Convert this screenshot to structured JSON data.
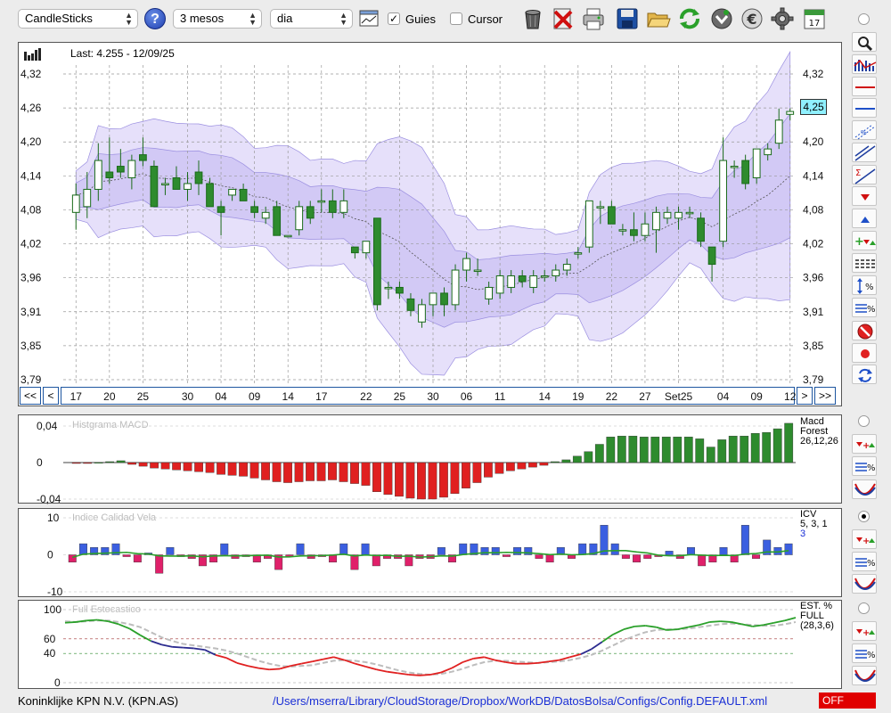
{
  "toolbar": {
    "chart_type": "CandleSticks",
    "period": "3 mesos",
    "interval": "dia",
    "guides_label": "Guies",
    "guides_checked": "✓",
    "cursor_label": "Cursor",
    "help": "?",
    "calendar_day": "17"
  },
  "nav": {
    "first": "<<",
    "prev": "<",
    "next": ">",
    "last": ">>"
  },
  "main_panel": {
    "last_info": "Last: 4.255 - 12/09/25",
    "price_tag": "4,25"
  },
  "macd_panel": {
    "label": "Histgrama MACD",
    "param1": "Macd",
    "param2": "Forest",
    "param3": "26,12,26",
    "ticks": [
      "0,04",
      "0",
      "-0,04"
    ]
  },
  "icv_panel": {
    "label": "Indice Calidad Vela",
    "param1": "ICV",
    "param2": "5, 3, 1",
    "param3": "3",
    "ticks": [
      "10",
      "0",
      "-10"
    ]
  },
  "stoch_panel": {
    "label": "Full Estocastico",
    "param1": "EST. %",
    "param2": "FULL",
    "param3": "(28,3,6)",
    "ticks": [
      "100",
      "60",
      "40",
      "0"
    ]
  },
  "status": {
    "security": "Koninklijke KPN N.V. (KPN.AS)",
    "path": "/Users/mserra/Library/CloudStorage/Dropbox/WorkDB/DatosBolsa/Configs/Config.DEFAULT.xml",
    "mode": "OFF"
  },
  "chart_data": {
    "type": "candlestick",
    "last_value": 4.255,
    "y_ticks": [
      "4,32",
      "4,26",
      "4,20",
      "4,14",
      "4,08",
      "4,02",
      "3,96",
      "3,91",
      "3,85",
      "3,79"
    ],
    "ylim": [
      3.79,
      4.32
    ],
    "x_labels": [
      "17",
      "20",
      "25",
      "30",
      "04",
      "09",
      "14",
      "17",
      "22",
      "25",
      "30",
      "06",
      "11",
      "14",
      "19",
      "22",
      "27",
      "Set25",
      "04",
      "09",
      "12"
    ],
    "candles": [
      {
        "o": 4.08,
        "h": 4.13,
        "l": 4.05,
        "c": 4.11
      },
      {
        "o": 4.09,
        "h": 4.15,
        "l": 4.07,
        "c": 4.12
      },
      {
        "o": 4.12,
        "h": 4.2,
        "l": 4.1,
        "c": 4.17
      },
      {
        "o": 4.15,
        "h": 4.21,
        "l": 4.13,
        "c": 4.14
      },
      {
        "o": 4.16,
        "h": 4.19,
        "l": 4.14,
        "c": 4.15
      },
      {
        "o": 4.14,
        "h": 4.18,
        "l": 4.12,
        "c": 4.17
      },
      {
        "o": 4.18,
        "h": 4.21,
        "l": 4.16,
        "c": 4.17
      },
      {
        "o": 4.16,
        "h": 4.17,
        "l": 4.09,
        "c": 4.09
      },
      {
        "o": 4.13,
        "h": 4.14,
        "l": 4.11,
        "c": 4.13
      },
      {
        "o": 4.14,
        "h": 4.16,
        "l": 4.12,
        "c": 4.12
      },
      {
        "o": 4.12,
        "h": 4.15,
        "l": 4.1,
        "c": 4.13
      },
      {
        "o": 4.15,
        "h": 4.17,
        "l": 4.11,
        "c": 4.13
      },
      {
        "o": 4.13,
        "h": 4.14,
        "l": 4.09,
        "c": 4.09
      },
      {
        "o": 4.09,
        "h": 4.1,
        "l": 4.04,
        "c": 4.08
      },
      {
        "o": 4.11,
        "h": 4.12,
        "l": 4.1,
        "c": 4.12
      },
      {
        "o": 4.12,
        "h": 4.13,
        "l": 4.1,
        "c": 4.1
      },
      {
        "o": 4.09,
        "h": 4.1,
        "l": 4.07,
        "c": 4.08
      },
      {
        "o": 4.07,
        "h": 4.09,
        "l": 4.06,
        "c": 4.08
      },
      {
        "o": 4.09,
        "h": 4.1,
        "l": 4.04,
        "c": 4.04
      },
      {
        "o": 4.04,
        "h": 4.04,
        "l": 4.04,
        "c": 4.04
      },
      {
        "o": 4.05,
        "h": 4.1,
        "l": 4.04,
        "c": 4.09
      },
      {
        "o": 4.09,
        "h": 4.1,
        "l": 4.06,
        "c": 4.07
      },
      {
        "o": 4.1,
        "h": 4.12,
        "l": 4.08,
        "c": 4.1
      },
      {
        "o": 4.1,
        "h": 4.12,
        "l": 4.07,
        "c": 4.08
      },
      {
        "o": 4.08,
        "h": 4.12,
        "l": 4.07,
        "c": 4.1
      },
      {
        "o": 4.02,
        "h": 4.02,
        "l": 4.0,
        "c": 4.01
      },
      {
        "o": 4.01,
        "h": 4.03,
        "l": 4.0,
        "c": 4.03
      },
      {
        "o": 4.07,
        "h": 4.07,
        "l": 3.91,
        "c": 3.92
      },
      {
        "o": 3.95,
        "h": 3.96,
        "l": 3.93,
        "c": 3.95
      },
      {
        "o": 3.95,
        "h": 3.96,
        "l": 3.93,
        "c": 3.94
      },
      {
        "o": 3.93,
        "h": 3.94,
        "l": 3.9,
        "c": 3.91
      },
      {
        "o": 3.89,
        "h": 3.93,
        "l": 3.88,
        "c": 3.92
      },
      {
        "o": 3.92,
        "h": 3.94,
        "l": 3.9,
        "c": 3.94
      },
      {
        "o": 3.94,
        "h": 3.95,
        "l": 3.9,
        "c": 3.92
      },
      {
        "o": 3.92,
        "h": 3.99,
        "l": 3.91,
        "c": 3.98
      },
      {
        "o": 3.98,
        "h": 4.01,
        "l": 3.96,
        "c": 4.0
      },
      {
        "o": 3.98,
        "h": 4.0,
        "l": 3.97,
        "c": 3.98
      },
      {
        "o": 3.93,
        "h": 3.96,
        "l": 3.92,
        "c": 3.95
      },
      {
        "o": 3.94,
        "h": 3.98,
        "l": 3.93,
        "c": 3.97
      },
      {
        "o": 3.95,
        "h": 3.98,
        "l": 3.94,
        "c": 3.97
      },
      {
        "o": 3.97,
        "h": 3.98,
        "l": 3.95,
        "c": 3.96
      },
      {
        "o": 3.95,
        "h": 3.98,
        "l": 3.94,
        "c": 3.97
      },
      {
        "o": 3.97,
        "h": 3.98,
        "l": 3.96,
        "c": 3.97
      },
      {
        "o": 3.97,
        "h": 3.99,
        "l": 3.96,
        "c": 3.98
      },
      {
        "o": 3.98,
        "h": 4.0,
        "l": 3.97,
        "c": 3.99
      },
      {
        "o": 4.01,
        "h": 4.02,
        "l": 4.0,
        "c": 4.01
      },
      {
        "o": 4.02,
        "h": 4.1,
        "l": 4.01,
        "c": 4.1
      },
      {
        "o": 4.09,
        "h": 4.1,
        "l": 4.06,
        "c": 4.09
      },
      {
        "o": 4.09,
        "h": 4.1,
        "l": 4.06,
        "c": 4.06
      },
      {
        "o": 4.05,
        "h": 4.06,
        "l": 4.04,
        "c": 4.05
      },
      {
        "o": 4.05,
        "h": 4.08,
        "l": 4.03,
        "c": 4.04
      },
      {
        "o": 4.04,
        "h": 4.08,
        "l": 4.03,
        "c": 4.06
      },
      {
        "o": 4.05,
        "h": 4.09,
        "l": 4.01,
        "c": 4.08
      },
      {
        "o": 4.07,
        "h": 4.09,
        "l": 4.06,
        "c": 4.08
      },
      {
        "o": 4.07,
        "h": 4.09,
        "l": 4.05,
        "c": 4.08
      },
      {
        "o": 4.08,
        "h": 4.09,
        "l": 4.07,
        "c": 4.08
      },
      {
        "o": 4.07,
        "h": 4.08,
        "l": 4.02,
        "c": 4.03
      },
      {
        "o": 4.02,
        "h": 4.02,
        "l": 3.96,
        "c": 3.99
      },
      {
        "o": 4.03,
        "h": 4.21,
        "l": 4.02,
        "c": 4.17
      },
      {
        "o": 4.16,
        "h": 4.17,
        "l": 4.14,
        "c": 4.16
      },
      {
        "o": 4.17,
        "h": 4.18,
        "l": 4.12,
        "c": 4.13
      },
      {
        "o": 4.14,
        "h": 4.19,
        "l": 4.13,
        "c": 4.19
      },
      {
        "o": 4.18,
        "h": 4.2,
        "l": 4.17,
        "c": 4.19
      },
      {
        "o": 4.2,
        "h": 4.26,
        "l": 4.19,
        "c": 4.24
      },
      {
        "o": 4.25,
        "h": 4.26,
        "l": 4.24,
        "c": 4.255
      }
    ],
    "macd_histogram": [
      -0.0005,
      -0.0005,
      0.0002,
      0.001,
      0.002,
      -0.002,
      -0.004,
      -0.006,
      -0.007,
      -0.008,
      -0.009,
      -0.01,
      -0.011,
      -0.013,
      -0.014,
      -0.015,
      -0.017,
      -0.019,
      -0.021,
      -0.022,
      -0.021,
      -0.02,
      -0.02,
      -0.019,
      -0.021,
      -0.023,
      -0.025,
      -0.032,
      -0.035,
      -0.037,
      -0.039,
      -0.04,
      -0.04,
      -0.038,
      -0.034,
      -0.028,
      -0.022,
      -0.016,
      -0.012,
      -0.009,
      -0.007,
      -0.005,
      -0.003,
      0.001,
      0.003,
      0.007,
      0.012,
      0.02,
      0.028,
      0.029,
      0.029,
      0.028,
      0.028,
      0.028,
      0.028,
      0.028,
      0.026,
      0.017,
      0.025,
      0.029,
      0.029,
      0.032,
      0.033,
      0.037,
      0.043
    ],
    "icv_bars": [
      -2,
      3,
      2,
      2,
      3,
      -0.5,
      -2,
      0.5,
      -5,
      2,
      -0.5,
      -1,
      -3,
      -2,
      3,
      -1,
      -0.5,
      -2,
      -1,
      -4,
      -0.5,
      3,
      -1,
      -0.5,
      -2,
      3,
      -4,
      3,
      -3,
      -1,
      -1,
      -3,
      -1,
      -1,
      2,
      -2,
      3,
      3,
      2,
      2,
      -0.5,
      2,
      2,
      -1,
      -2,
      2,
      -1,
      3,
      3,
      8,
      3,
      -1,
      -2,
      -1,
      -0.5,
      1,
      -1,
      2,
      -3,
      -2,
      2,
      -2,
      8,
      -1,
      4,
      2,
      3
    ],
    "stoch_k": [
      82,
      83,
      85,
      86,
      84,
      80,
      74,
      65,
      57,
      52,
      49,
      48,
      47,
      45,
      38,
      34,
      27,
      23,
      20,
      18,
      19,
      23,
      26,
      29,
      32,
      35,
      31,
      26,
      22,
      18,
      15,
      13,
      11,
      10,
      11,
      14,
      20,
      28,
      33,
      35,
      31,
      28,
      26,
      26,
      27,
      29,
      31,
      35,
      39,
      46,
      56,
      66,
      73,
      77,
      78,
      76,
      72,
      73,
      76,
      79,
      83,
      84,
      83,
      80,
      77,
      79,
      82,
      85,
      89
    ],
    "stoch_d": [
      84,
      83,
      84,
      85,
      85,
      83,
      80,
      76,
      69,
      62,
      57,
      53,
      51,
      49,
      47,
      44,
      40,
      35,
      30,
      26,
      23,
      22,
      23,
      24,
      27,
      30,
      31,
      30,
      28,
      25,
      21,
      17,
      14,
      12,
      11,
      12,
      15,
      19,
      24,
      28,
      30,
      30,
      29,
      28,
      27,
      28,
      29,
      31,
      34,
      38,
      44,
      51,
      58,
      64,
      69,
      72,
      73,
      73,
      74,
      76,
      78,
      80,
      81,
      80,
      79,
      78,
      78,
      80,
      83
    ]
  }
}
